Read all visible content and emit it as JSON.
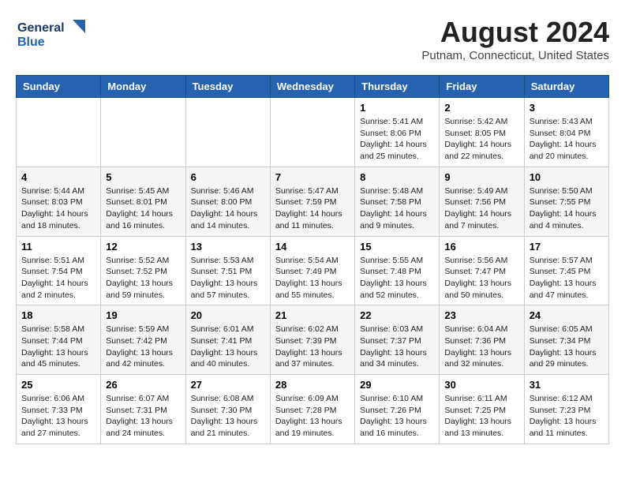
{
  "header": {
    "logo_line1": "General",
    "logo_line2": "Blue",
    "month": "August 2024",
    "location": "Putnam, Connecticut, United States"
  },
  "days_of_week": [
    "Sunday",
    "Monday",
    "Tuesday",
    "Wednesday",
    "Thursday",
    "Friday",
    "Saturday"
  ],
  "weeks": [
    [
      {
        "day": "",
        "info": ""
      },
      {
        "day": "",
        "info": ""
      },
      {
        "day": "",
        "info": ""
      },
      {
        "day": "",
        "info": ""
      },
      {
        "day": "1",
        "info": "Sunrise: 5:41 AM\nSunset: 8:06 PM\nDaylight: 14 hours\nand 25 minutes."
      },
      {
        "day": "2",
        "info": "Sunrise: 5:42 AM\nSunset: 8:05 PM\nDaylight: 14 hours\nand 22 minutes."
      },
      {
        "day": "3",
        "info": "Sunrise: 5:43 AM\nSunset: 8:04 PM\nDaylight: 14 hours\nand 20 minutes."
      }
    ],
    [
      {
        "day": "4",
        "info": "Sunrise: 5:44 AM\nSunset: 8:03 PM\nDaylight: 14 hours\nand 18 minutes."
      },
      {
        "day": "5",
        "info": "Sunrise: 5:45 AM\nSunset: 8:01 PM\nDaylight: 14 hours\nand 16 minutes."
      },
      {
        "day": "6",
        "info": "Sunrise: 5:46 AM\nSunset: 8:00 PM\nDaylight: 14 hours\nand 14 minutes."
      },
      {
        "day": "7",
        "info": "Sunrise: 5:47 AM\nSunset: 7:59 PM\nDaylight: 14 hours\nand 11 minutes."
      },
      {
        "day": "8",
        "info": "Sunrise: 5:48 AM\nSunset: 7:58 PM\nDaylight: 14 hours\nand 9 minutes."
      },
      {
        "day": "9",
        "info": "Sunrise: 5:49 AM\nSunset: 7:56 PM\nDaylight: 14 hours\nand 7 minutes."
      },
      {
        "day": "10",
        "info": "Sunrise: 5:50 AM\nSunset: 7:55 PM\nDaylight: 14 hours\nand 4 minutes."
      }
    ],
    [
      {
        "day": "11",
        "info": "Sunrise: 5:51 AM\nSunset: 7:54 PM\nDaylight: 14 hours\nand 2 minutes."
      },
      {
        "day": "12",
        "info": "Sunrise: 5:52 AM\nSunset: 7:52 PM\nDaylight: 13 hours\nand 59 minutes."
      },
      {
        "day": "13",
        "info": "Sunrise: 5:53 AM\nSunset: 7:51 PM\nDaylight: 13 hours\nand 57 minutes."
      },
      {
        "day": "14",
        "info": "Sunrise: 5:54 AM\nSunset: 7:49 PM\nDaylight: 13 hours\nand 55 minutes."
      },
      {
        "day": "15",
        "info": "Sunrise: 5:55 AM\nSunset: 7:48 PM\nDaylight: 13 hours\nand 52 minutes."
      },
      {
        "day": "16",
        "info": "Sunrise: 5:56 AM\nSunset: 7:47 PM\nDaylight: 13 hours\nand 50 minutes."
      },
      {
        "day": "17",
        "info": "Sunrise: 5:57 AM\nSunset: 7:45 PM\nDaylight: 13 hours\nand 47 minutes."
      }
    ],
    [
      {
        "day": "18",
        "info": "Sunrise: 5:58 AM\nSunset: 7:44 PM\nDaylight: 13 hours\nand 45 minutes."
      },
      {
        "day": "19",
        "info": "Sunrise: 5:59 AM\nSunset: 7:42 PM\nDaylight: 13 hours\nand 42 minutes."
      },
      {
        "day": "20",
        "info": "Sunrise: 6:01 AM\nSunset: 7:41 PM\nDaylight: 13 hours\nand 40 minutes."
      },
      {
        "day": "21",
        "info": "Sunrise: 6:02 AM\nSunset: 7:39 PM\nDaylight: 13 hours\nand 37 minutes."
      },
      {
        "day": "22",
        "info": "Sunrise: 6:03 AM\nSunset: 7:37 PM\nDaylight: 13 hours\nand 34 minutes."
      },
      {
        "day": "23",
        "info": "Sunrise: 6:04 AM\nSunset: 7:36 PM\nDaylight: 13 hours\nand 32 minutes."
      },
      {
        "day": "24",
        "info": "Sunrise: 6:05 AM\nSunset: 7:34 PM\nDaylight: 13 hours\nand 29 minutes."
      }
    ],
    [
      {
        "day": "25",
        "info": "Sunrise: 6:06 AM\nSunset: 7:33 PM\nDaylight: 13 hours\nand 27 minutes."
      },
      {
        "day": "26",
        "info": "Sunrise: 6:07 AM\nSunset: 7:31 PM\nDaylight: 13 hours\nand 24 minutes."
      },
      {
        "day": "27",
        "info": "Sunrise: 6:08 AM\nSunset: 7:30 PM\nDaylight: 13 hours\nand 21 minutes."
      },
      {
        "day": "28",
        "info": "Sunrise: 6:09 AM\nSunset: 7:28 PM\nDaylight: 13 hours\nand 19 minutes."
      },
      {
        "day": "29",
        "info": "Sunrise: 6:10 AM\nSunset: 7:26 PM\nDaylight: 13 hours\nand 16 minutes."
      },
      {
        "day": "30",
        "info": "Sunrise: 6:11 AM\nSunset: 7:25 PM\nDaylight: 13 hours\nand 13 minutes."
      },
      {
        "day": "31",
        "info": "Sunrise: 6:12 AM\nSunset: 7:23 PM\nDaylight: 13 hours\nand 11 minutes."
      }
    ]
  ]
}
